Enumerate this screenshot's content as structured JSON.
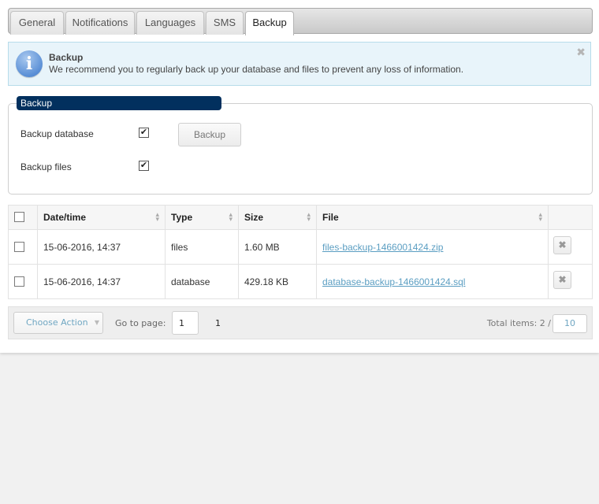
{
  "tabs": [
    {
      "label": "General",
      "active": false
    },
    {
      "label": "Notifications",
      "active": false
    },
    {
      "label": "Languages",
      "active": false
    },
    {
      "label": "SMS",
      "active": false
    },
    {
      "label": "Backup",
      "active": true
    }
  ],
  "alert": {
    "icon": "info-icon",
    "title": "Backup",
    "message": "We recommend you to regularly back up your database and files to prevent any loss of information.",
    "close_glyph": "✖"
  },
  "backup_panel": {
    "legend": "Backup",
    "fields": [
      {
        "label": "Backup database",
        "checked": true
      },
      {
        "label": "Backup files",
        "checked": true
      }
    ],
    "backup_button": "Backup",
    "check_glyph": "✔"
  },
  "table": {
    "columns": [
      "Date/time",
      "Type",
      "Size",
      "File"
    ],
    "rows": [
      {
        "datetime": "15-06-2016, 14:37",
        "type": "files",
        "size": "1.60 MB",
        "file": "files-backup-1466001424.zip"
      },
      {
        "datetime": "15-06-2016, 14:37",
        "type": "database",
        "size": "429.18 KB",
        "file": "database-backup-1466001424.sql"
      }
    ],
    "delete_glyph": "✖",
    "sort_glyph": "⌃⌄"
  },
  "footer": {
    "choose_action": "Choose Action",
    "goto_label": "Go to page:",
    "goto_value": "1",
    "page_count": "1",
    "total_items": "Total items: 2 /",
    "page_size": "10"
  }
}
